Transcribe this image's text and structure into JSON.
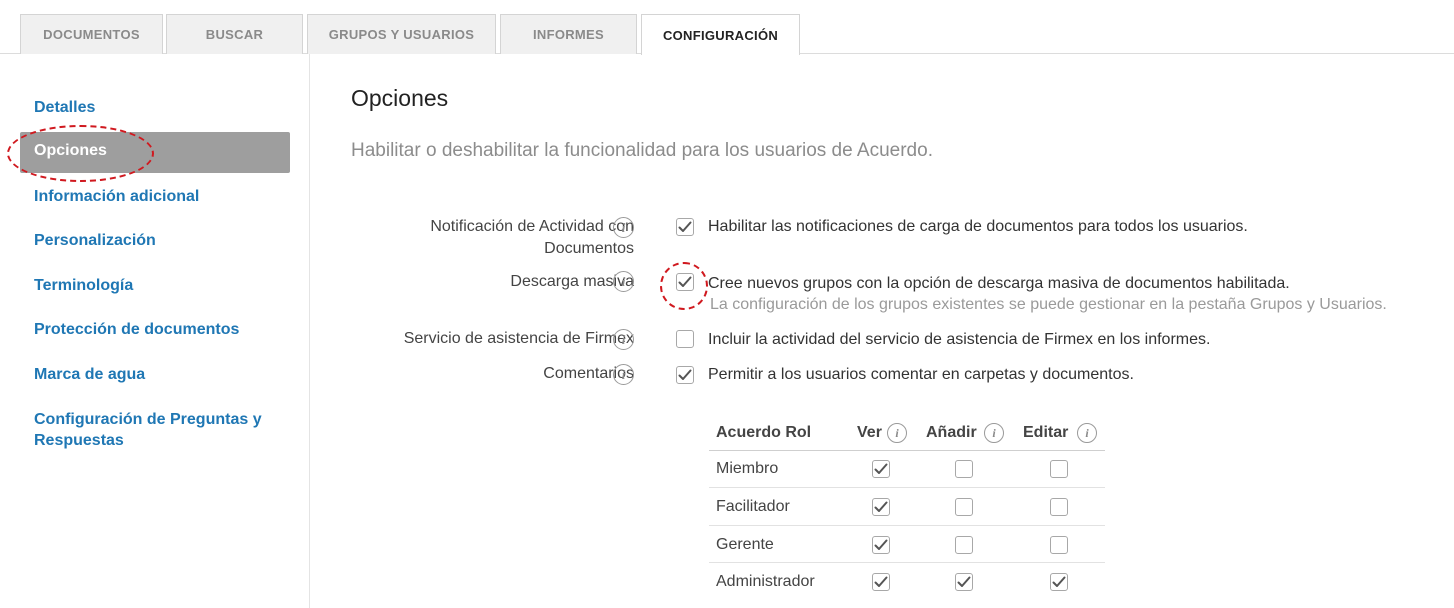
{
  "tabs": [
    {
      "label": "DOCUMENTOS",
      "active": false
    },
    {
      "label": "BUSCAR",
      "active": false
    },
    {
      "label": "GRUPOS Y USUARIOS",
      "active": false
    },
    {
      "label": "INFORMES",
      "active": false
    },
    {
      "label": "CONFIGURACIÓN",
      "active": true
    }
  ],
  "sidebar": {
    "items": [
      {
        "label": "Detalles"
      },
      {
        "label": "Opciones",
        "active": true
      },
      {
        "label": "Información adicional"
      },
      {
        "label": "Personalización"
      },
      {
        "label": "Terminología"
      },
      {
        "label": "Protección de documentos"
      },
      {
        "label": "Marca de agua"
      },
      {
        "label": "Configuración de Preguntas y",
        "label2": "Respuestas"
      }
    ]
  },
  "main": {
    "title": "Opciones",
    "subtitle": "Habilitar o deshabilitar la funcionalidad para los usuarios de Acuerdo.",
    "options": [
      {
        "label": "Notificación de Actividad con",
        "label2": "Documentos",
        "checked": true,
        "text": "Habilitar las notificaciones de carga de documentos para todos los usuarios."
      },
      {
        "label": "Descarga masiva",
        "checked": true,
        "text": "Cree nuevos grupos con la opción de descarga masiva de documentos habilitada.",
        "subtext": "La configuración de los grupos existentes se puede gestionar en la pestaña Grupos y Usuarios."
      },
      {
        "label": "Servicio de asistencia de Firmex",
        "checked": false,
        "text": "Incluir la actividad del servicio de asistencia de Firmex en los informes."
      },
      {
        "label": "Comentarios",
        "checked": true,
        "text": "Permitir a los usuarios comentar en carpetas y documentos."
      }
    ],
    "roles_table": {
      "headers": [
        "Acuerdo Rol",
        "Ver",
        "Añadir",
        "Editar"
      ],
      "rows": [
        {
          "role": "Miembro",
          "ver": true,
          "anadir": false,
          "editar": false
        },
        {
          "role": "Facilitador",
          "ver": true,
          "anadir": false,
          "editar": false
        },
        {
          "role": "Gerente",
          "ver": true,
          "anadir": false,
          "editar": false
        },
        {
          "role": "Administrador",
          "ver": true,
          "anadir": true,
          "editar": true
        }
      ]
    }
  },
  "icons": {
    "info": "info-icon",
    "check": "checkmark-icon"
  },
  "info_glyph": "i",
  "colors": {
    "link": "#1f77b4",
    "active_bg": "#9e9e9e",
    "highlight": "#d0191f"
  }
}
